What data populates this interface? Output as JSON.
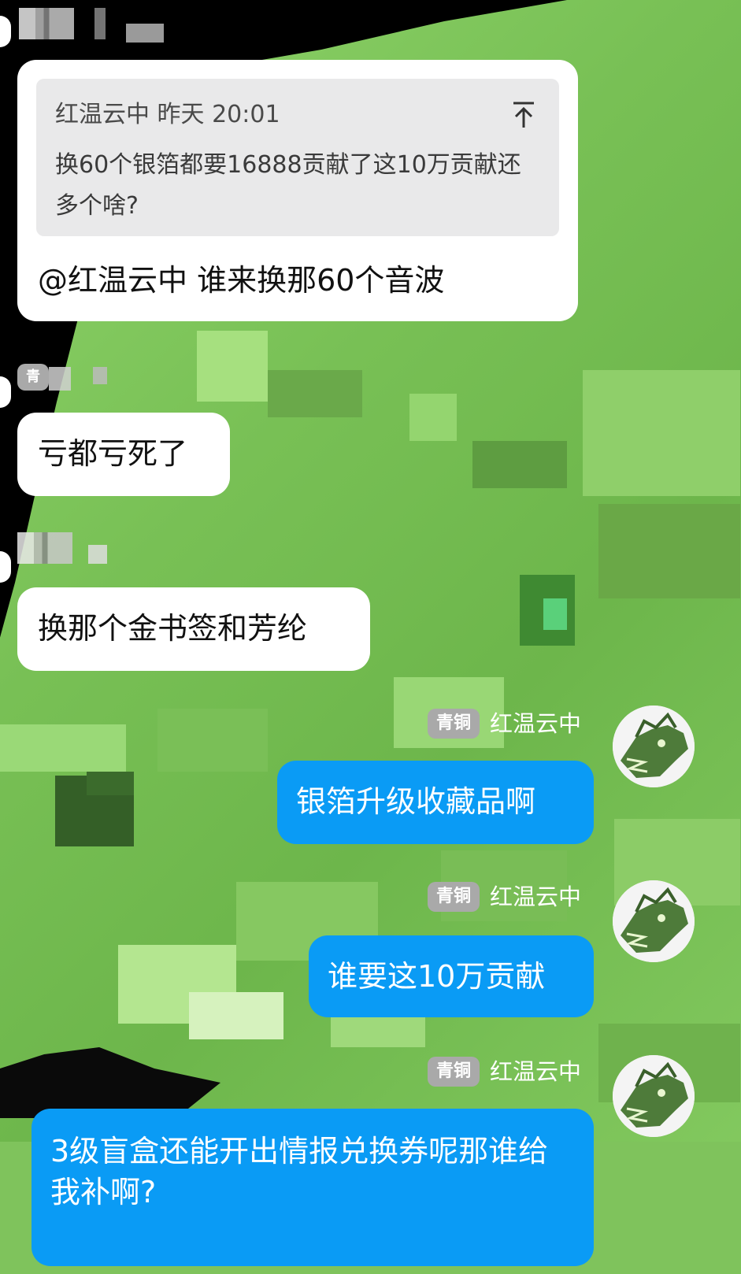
{
  "colors": {
    "self_bubble": "#0a9bf5",
    "other_bubble": "#ffffff",
    "quote_bg": "#e9e9ea",
    "badge_bg": "#a9a9a9"
  },
  "messages": [
    {
      "side": "left",
      "quote": {
        "author_time": "红温云中 昨天 20:01",
        "text": "换60个银箔都要16888贡献了这10万贡献还多个啥?"
      },
      "text": "@红温云中 谁来换那60个音波",
      "icon": "arrow-up-to-top-icon"
    },
    {
      "side": "left",
      "text": "亏都亏死了",
      "badge": "青"
    },
    {
      "side": "left",
      "text": "换那个金书签和芳纶"
    },
    {
      "side": "right",
      "badge": "青铜",
      "sender": "红温云中",
      "text": "银箔升级收藏品啊",
      "avatar": "dragon-avatar-icon"
    },
    {
      "side": "right",
      "badge": "青铜",
      "sender": "红温云中",
      "text": "谁要这10万贡献",
      "avatar": "dragon-avatar-icon"
    },
    {
      "side": "right",
      "badge": "青铜",
      "sender": "红温云中",
      "text": "3级盲盒还能开出情报兑换券呢那谁给我补啊?",
      "avatar": "dragon-avatar-icon"
    }
  ]
}
